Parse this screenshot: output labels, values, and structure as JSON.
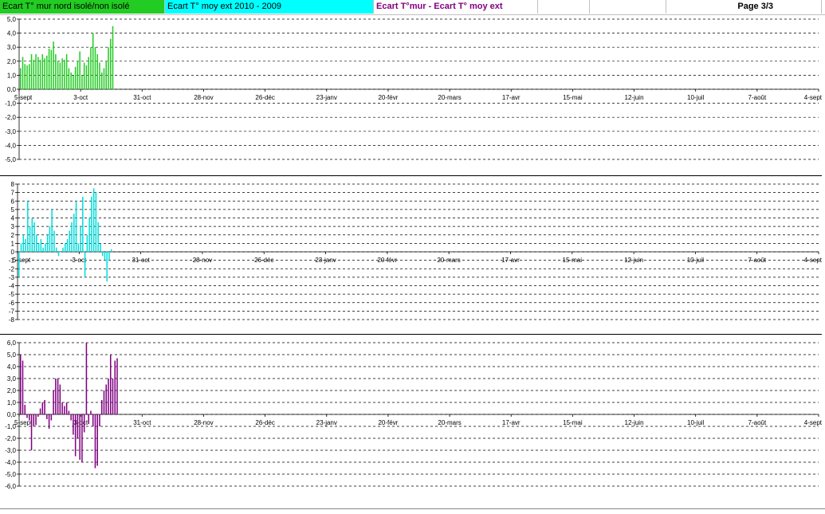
{
  "header": {
    "tab1": "Ecart T° mur nord isolé/non isolé",
    "tab2": "Ecart T° moy ext 2010 - 2009",
    "tab3": "Ecart T°mur - Ecart T° moy ext",
    "page": "Page 3/3",
    "colors": {
      "tab1": "#22cc22",
      "tab2": "#00ffff",
      "tab3_text": "#800080"
    }
  },
  "chart_data": [
    {
      "type": "bar",
      "color": "#22cc22",
      "ylim": [
        -5,
        5
      ],
      "yticks": [
        "5,0",
        "4,0",
        "3,0",
        "2,0",
        "1,0",
        "0,0",
        "-1,0",
        "-2,0",
        "-3,0",
        "-4,0",
        "-5,0"
      ],
      "xticks": [
        "5-sept",
        "3-oct",
        "31-oct",
        "28-nov",
        "26-déc",
        "23-janv",
        "20-févr",
        "20-mars",
        "17-avr",
        "15-mai",
        "12-juin",
        "10-juil",
        "7-août",
        "4-sept"
      ],
      "values": [
        1.5,
        2.3,
        1.8,
        1.7,
        1.8,
        2.5,
        2.1,
        2.5,
        2.3,
        2.1,
        2.5,
        2.2,
        2.4,
        2.9,
        2.8,
        3.4,
        2.5,
        2.0,
        1.9,
        2.2,
        2.1,
        2.5,
        1.5,
        1.2,
        1.0,
        1.6,
        2.0,
        2.7,
        1.0,
        1.9,
        1.7,
        2.3,
        3.0,
        4.0,
        3.0,
        2.5,
        1.9,
        1.2,
        1.5,
        2.0,
        3.0,
        3.6,
        4.5
      ]
    },
    {
      "type": "bar",
      "color": "#00dddd",
      "ylim": [
        -8,
        8
      ],
      "yticks": [
        "8",
        "7",
        "6",
        "5",
        "4",
        "3",
        "2",
        "1",
        "0",
        "-1",
        "-2",
        "-3",
        "-4",
        "-5",
        "-6",
        "-7",
        "-8"
      ],
      "xticks": [
        "5-sept",
        "3-oct",
        "31-oct",
        "28-nov",
        "26-déc",
        "23-janv",
        "20-févr",
        "20-mars",
        "17-avr",
        "15-mai",
        "12-juin",
        "10-juil",
        "7-août",
        "4-sept"
      ],
      "values": [
        -3,
        1,
        2,
        1.5,
        6,
        3,
        4,
        3.5,
        2,
        1,
        1.5,
        0.5,
        1,
        2,
        3,
        5,
        2.5,
        0.5,
        -0.5,
        0,
        0.5,
        1,
        1.5,
        2.5,
        3.5,
        4.5,
        6,
        1,
        3,
        6.5,
        -3,
        2,
        4,
        6.5,
        7.5,
        7,
        3.5,
        1,
        -0.5,
        -1,
        -3.5,
        -1,
        0.3
      ]
    },
    {
      "type": "bar",
      "color": "#800080",
      "ylim": [
        -6,
        6
      ],
      "yticks": [
        "6,0",
        "5,0",
        "4,0",
        "3,0",
        "2,0",
        "1,0",
        "0,0",
        "-1,0",
        "-2,0",
        "-3,0",
        "-4,0",
        "-5,0",
        "-6,0"
      ],
      "xticks": [
        "5-sept",
        "3-oct",
        "31-oct",
        "28-nov",
        "26-déc",
        "23-janv",
        "20-févr",
        "20-mars",
        "17-avr",
        "15-mai",
        "12-juin",
        "10-juil",
        "7-août",
        "4-sept"
      ],
      "values": [
        5,
        4.5,
        0.8,
        -0.3,
        -0.5,
        -3,
        -1,
        -0.9,
        -0.2,
        0.5,
        1,
        1.2,
        -0.4,
        -1.2,
        -0.5,
        2,
        3,
        3,
        2.5,
        1,
        0.7,
        1,
        0.3,
        -0.5,
        -1.7,
        -3.5,
        -2,
        -3.8,
        -4,
        -1.5,
        6,
        -0.8,
        0.3,
        -1,
        -4.5,
        -4.3,
        -1,
        1.2,
        2,
        2.5,
        3,
        5,
        3,
        4.5,
        4.7
      ]
    }
  ]
}
